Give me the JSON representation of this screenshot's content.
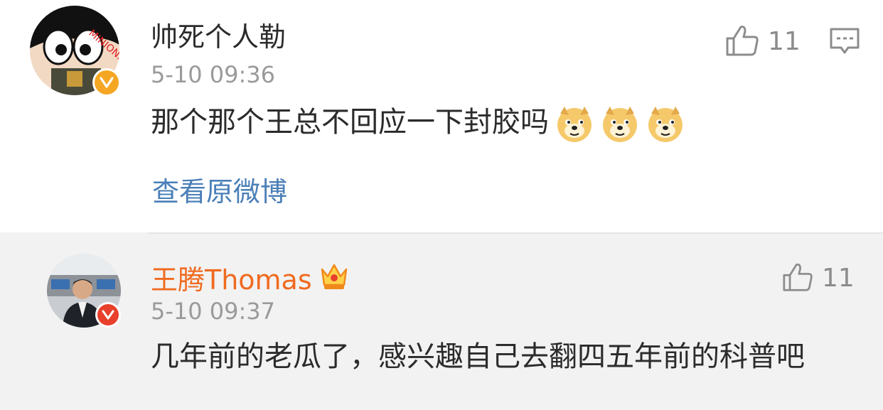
{
  "comment": {
    "username": "帅死个人勒",
    "time": "5-10 09:36",
    "text": "那个那个王总不回应一下封胶吗",
    "emoji": [
      "doge",
      "doge",
      "doge"
    ],
    "likes": "11",
    "view_original": "查看原微博"
  },
  "reply": {
    "username": "王腾Thomas",
    "time": "5-10 09:37",
    "text": "几年前的老瓜了，感兴趣自己去翻四五年前的科普吧",
    "likes": "11"
  },
  "colors": {
    "reply_username": "#f06a1f",
    "link": "#4a7fb7",
    "verified_orange": "#f5a623",
    "verified_red": "#e8402b"
  }
}
